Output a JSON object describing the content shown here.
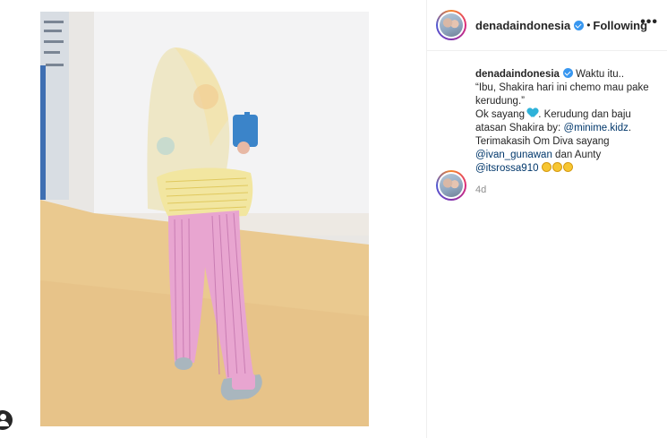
{
  "post": {
    "username": "denadaindonesia",
    "separator": "•",
    "follow_state": "Following",
    "more_label": "•••"
  },
  "caption": {
    "username": "denadaindonesia",
    "line1": "Waktu itu..",
    "line2": "“Ibu, Shakira hari ini chemo mau pake",
    "line3": "kerudung.”",
    "line4_pre": "Ok sayang",
    "line4_post": ". Kerudung dan baju",
    "line5_pre": "atasan Shakira by: ",
    "mention1": "@minime.kidz",
    "line5_post": ".",
    "line6": "Terimakasih Om Diva sayang",
    "mention2": "@ivan_gunawan",
    "line7_mid": " dan Aunty",
    "mention3": "@itsrossa910",
    "emoji_icon": "hugging-face-emoji",
    "heart_icon": "blue-heart-emoji"
  },
  "timestamp": "4d",
  "colors": {
    "link": "#00376b",
    "verified": "#3897f0",
    "muted": "#8e8e8e"
  }
}
